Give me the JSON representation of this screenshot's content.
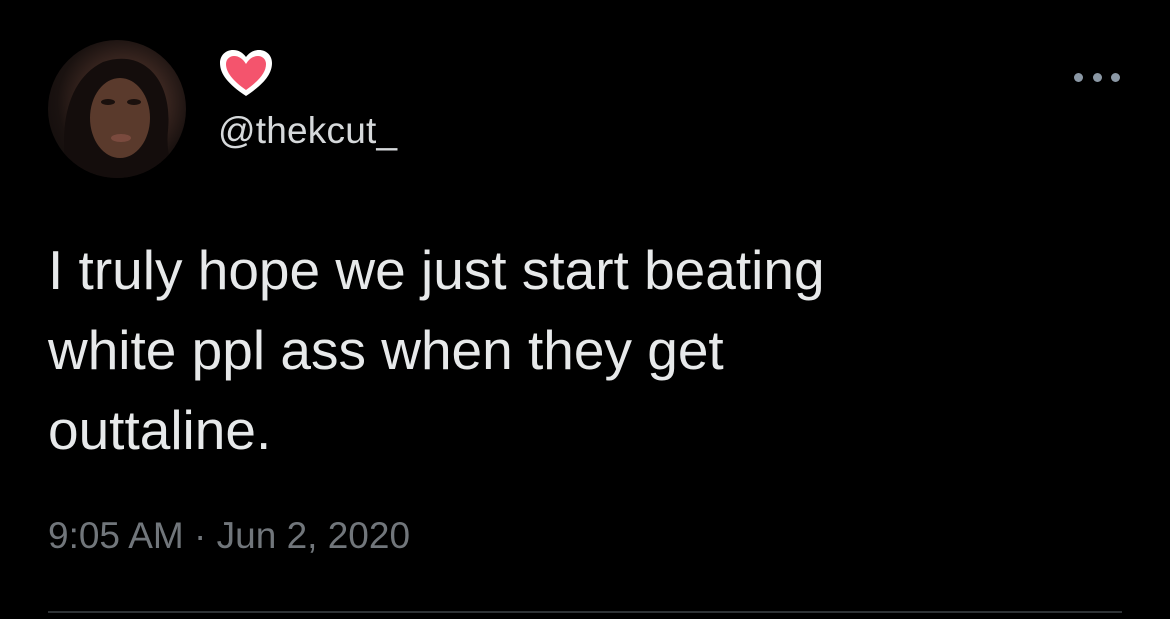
{
  "tweet": {
    "avatar_icon": "profile-photo",
    "badge_icon": "pink-heart-icon",
    "badge_color": "#f4546d",
    "handle": "@thekcut_",
    "more_icon": "more-options-icon",
    "text_lines": [
      "I truly hope we just start beating",
      "white ppl ass when they get",
      "outtaline."
    ],
    "time": "9:05 AM",
    "separator": "·",
    "date": "Jun 2, 2020"
  },
  "colors": {
    "background": "#000000",
    "primary_text": "#e7e9ea",
    "secondary_text": "#71767b",
    "divider": "#2f3336"
  }
}
